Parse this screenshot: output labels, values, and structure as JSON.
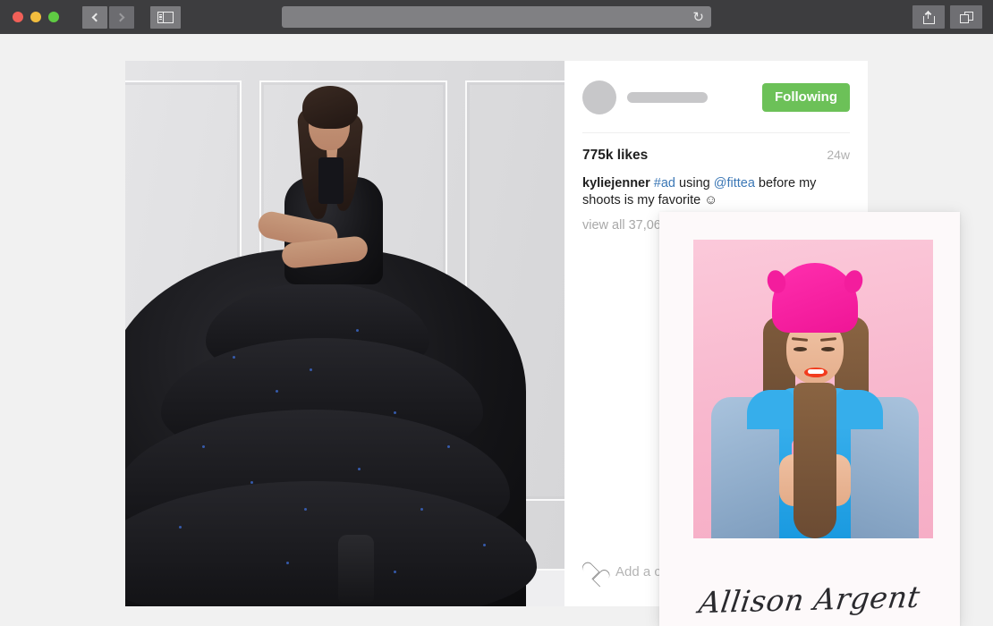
{
  "browser": {
    "traffic_lights": [
      "close",
      "minimize",
      "maximize"
    ],
    "back_label": "Back",
    "forward_label": "Forward",
    "sidebar_label": "Show Sidebar",
    "address_value": "",
    "address_placeholder": "",
    "reload_icon": "reload-icon",
    "share_label": "Share",
    "tabs_label": "Show Tab Overview"
  },
  "post": {
    "avatar": "avatar-placeholder",
    "username_placeholder": "",
    "follow_button": "Following",
    "likes": "775k likes",
    "timestamp": "24w",
    "caption": {
      "username": "kyliejenner",
      "hashtag": "#ad",
      "mid_text": "using",
      "mention": "@fittea",
      "tail_text": "before my shoots is my favorite",
      "emoji": "☺"
    },
    "view_all": "view all 37,06",
    "comment_placeholder": "Add a co",
    "like_icon": "heart-icon"
  },
  "overlay_card": {
    "photo_alt": "woman-in-pink-beanie-with-phone",
    "signature": "Allison Argent"
  },
  "colors": {
    "chrome": "#3d3d3f",
    "follow_green": "#6cc158",
    "link_blue": "#3b77b5",
    "page_bg": "#f1f1f1",
    "card_bg": "#fdf9fa",
    "beanie_pink": "#f31d9d",
    "backdrop_pink": "#f8b7cd"
  }
}
